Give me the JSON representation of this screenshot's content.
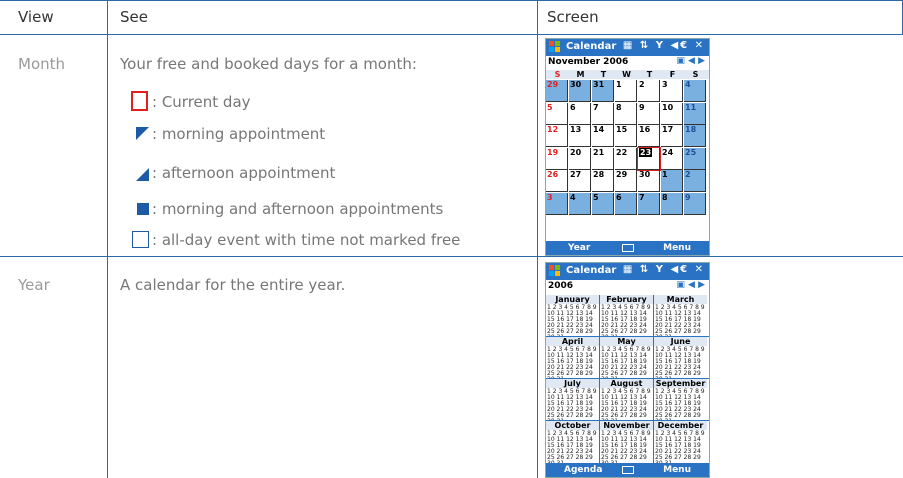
{
  "header": {
    "view": "View",
    "see": "See",
    "screen": "Screen"
  },
  "rows": [
    {
      "view": "Month",
      "description": "Your free and booked days for a month:",
      "legend": [
        {
          "icon": "current-day-icon",
          "label": ": Current day"
        },
        {
          "icon": "morning-appointment-icon",
          "label": ": morning appointment"
        },
        {
          "icon": "afternoon-appointment-icon",
          "label": ": afternoon appointment"
        },
        {
          "icon": "morning-afternoon-icon",
          "label": ": morning and afternoon appointments"
        },
        {
          "icon": "all-day-event-icon",
          "label": ": all-day event with time not marked free"
        }
      ]
    },
    {
      "view": "Year",
      "description": "A calendar for the entire year."
    }
  ],
  "month_screen": {
    "title": "Calendar",
    "month": "November 2006",
    "dow": [
      "S",
      "M",
      "T",
      "W",
      "T",
      "F",
      "S"
    ],
    "weeks": [
      [
        "29",
        "30",
        "31",
        "1",
        "2",
        "3",
        "4"
      ],
      [
        "5",
        "6",
        "7",
        "8",
        "9",
        "10",
        "11"
      ],
      [
        "12",
        "13",
        "14",
        "15",
        "16",
        "17",
        "18"
      ],
      [
        "19",
        "20",
        "21",
        "22",
        "23",
        "24",
        "25"
      ],
      [
        "26",
        "27",
        "28",
        "29",
        "30",
        "1",
        "2"
      ],
      [
        "3",
        "4",
        "5",
        "6",
        "7",
        "8",
        "9"
      ]
    ],
    "left_soft": "Year",
    "right_soft": "Menu"
  },
  "year_screen": {
    "title": "Calendar",
    "year": "2006",
    "months": [
      "January",
      "February",
      "March",
      "April",
      "May",
      "June",
      "July",
      "August",
      "September",
      "October",
      "November",
      "December"
    ],
    "left_soft": "Agenda",
    "right_soft": "Menu"
  },
  "colors": {
    "border": "#2b6aa8",
    "accent": "#2a73c4",
    "current_day": "#e02020",
    "sunday": "#e02020"
  }
}
